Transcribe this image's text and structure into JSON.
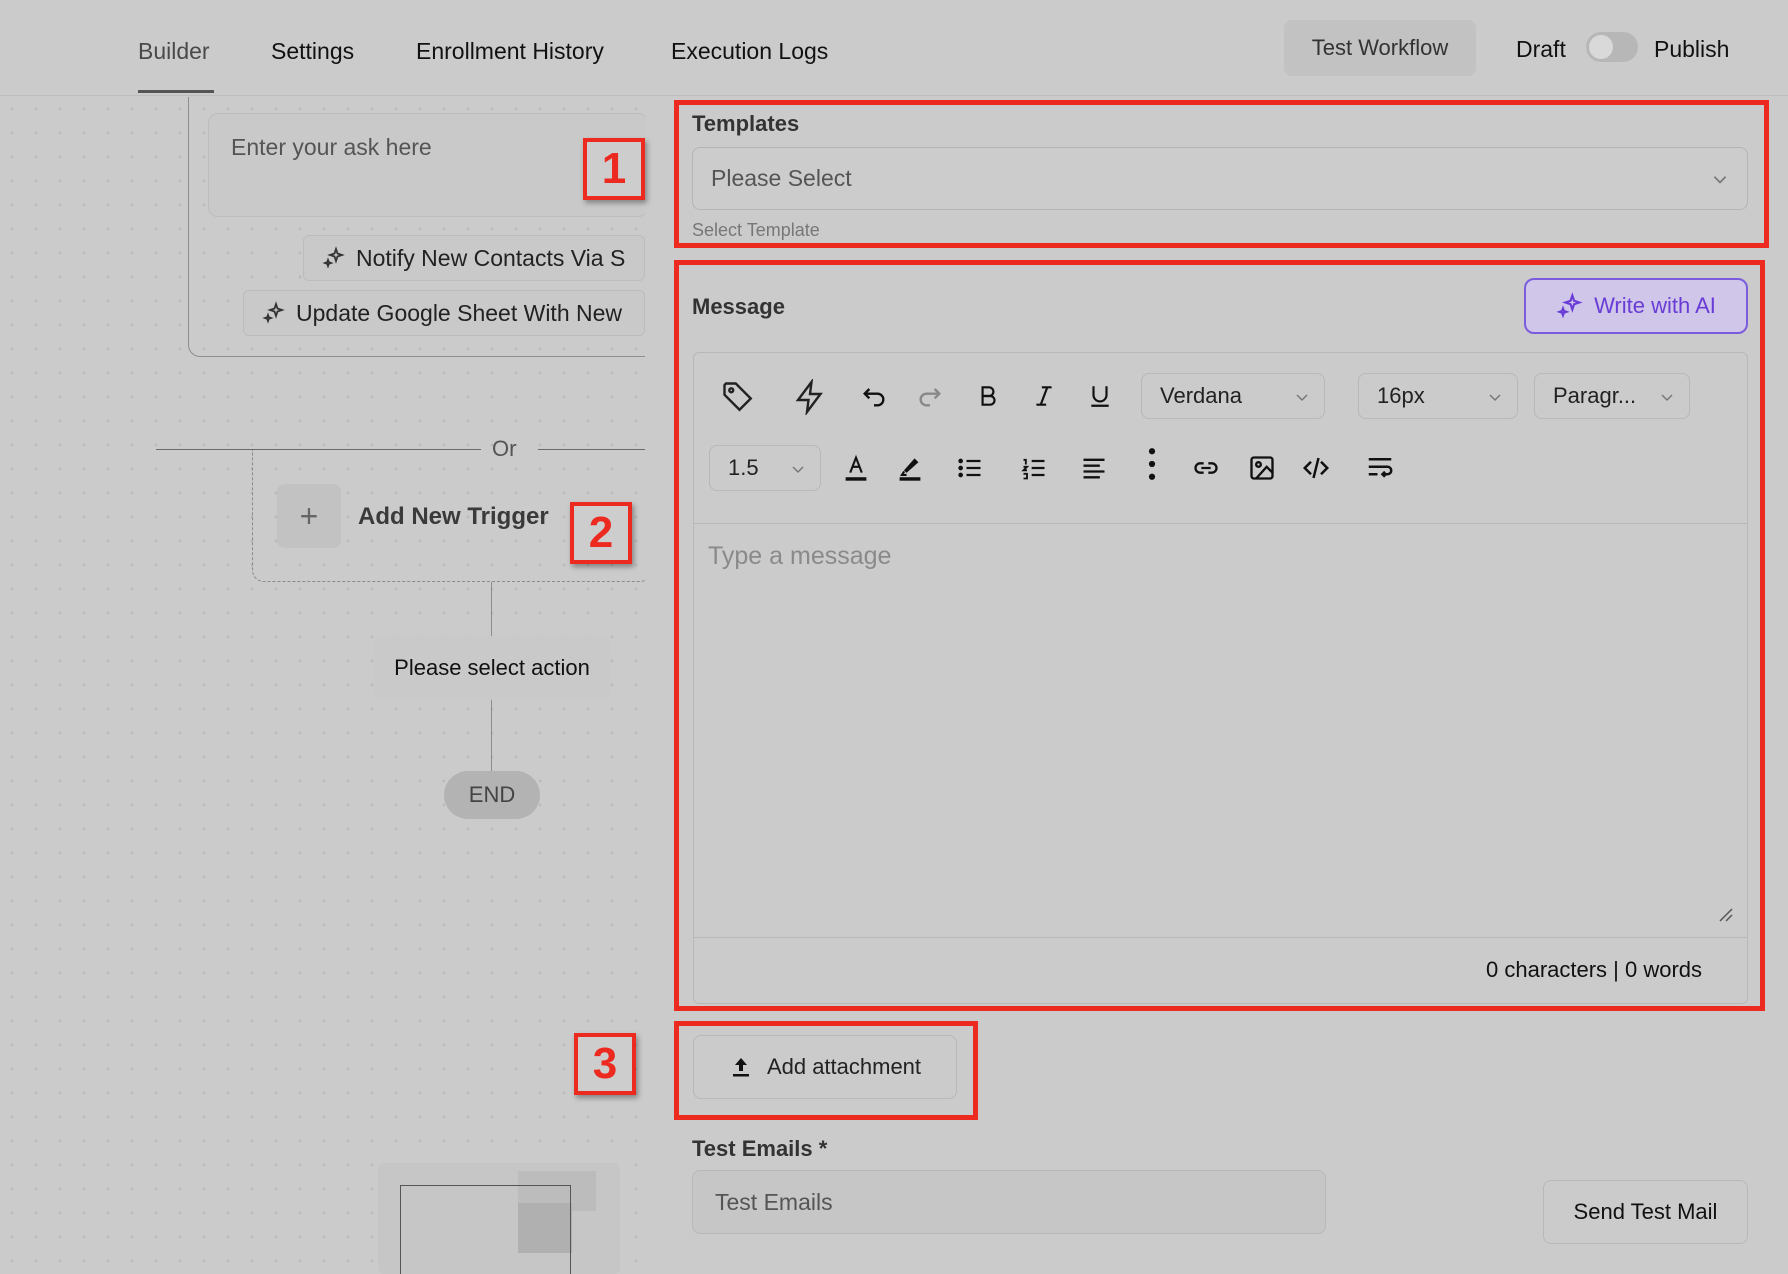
{
  "nav": {
    "tabs": [
      {
        "label": "Builder"
      },
      {
        "label": "Settings"
      },
      {
        "label": "Enrollment History"
      },
      {
        "label": "Execution Logs"
      }
    ],
    "test_workflow": "Test Workflow",
    "draft": "Draft",
    "publish": "Publish"
  },
  "canvas": {
    "ask_placeholder": "Enter your ask here",
    "suggestions": [
      {
        "label": "Notify New Contacts Via S"
      },
      {
        "label": "Update Google Sheet With New"
      }
    ],
    "or": "Or",
    "add_trigger": "Add New Trigger",
    "plus": "+",
    "select_action": "Please select action",
    "end": "END"
  },
  "panel": {
    "templates_label": "Templates",
    "templates_placeholder": "Please Select",
    "templates_help": "Select Template",
    "message_label": "Message",
    "write_ai": "Write with AI",
    "font": "Verdana",
    "font_size": "16px",
    "block_type": "Paragr...",
    "line_height": "1.5",
    "message_placeholder": "Type a message",
    "counter": "0 characters | 0 words",
    "add_attachment": "Add attachment",
    "test_emails_label": "Test Emails *",
    "test_emails_placeholder": "Test Emails",
    "send_test": "Send Test Mail"
  },
  "callouts": [
    "1",
    "2",
    "3"
  ],
  "colors": {
    "highlight": "#ec2a1f",
    "ai_accent": "#6a3cd6"
  }
}
